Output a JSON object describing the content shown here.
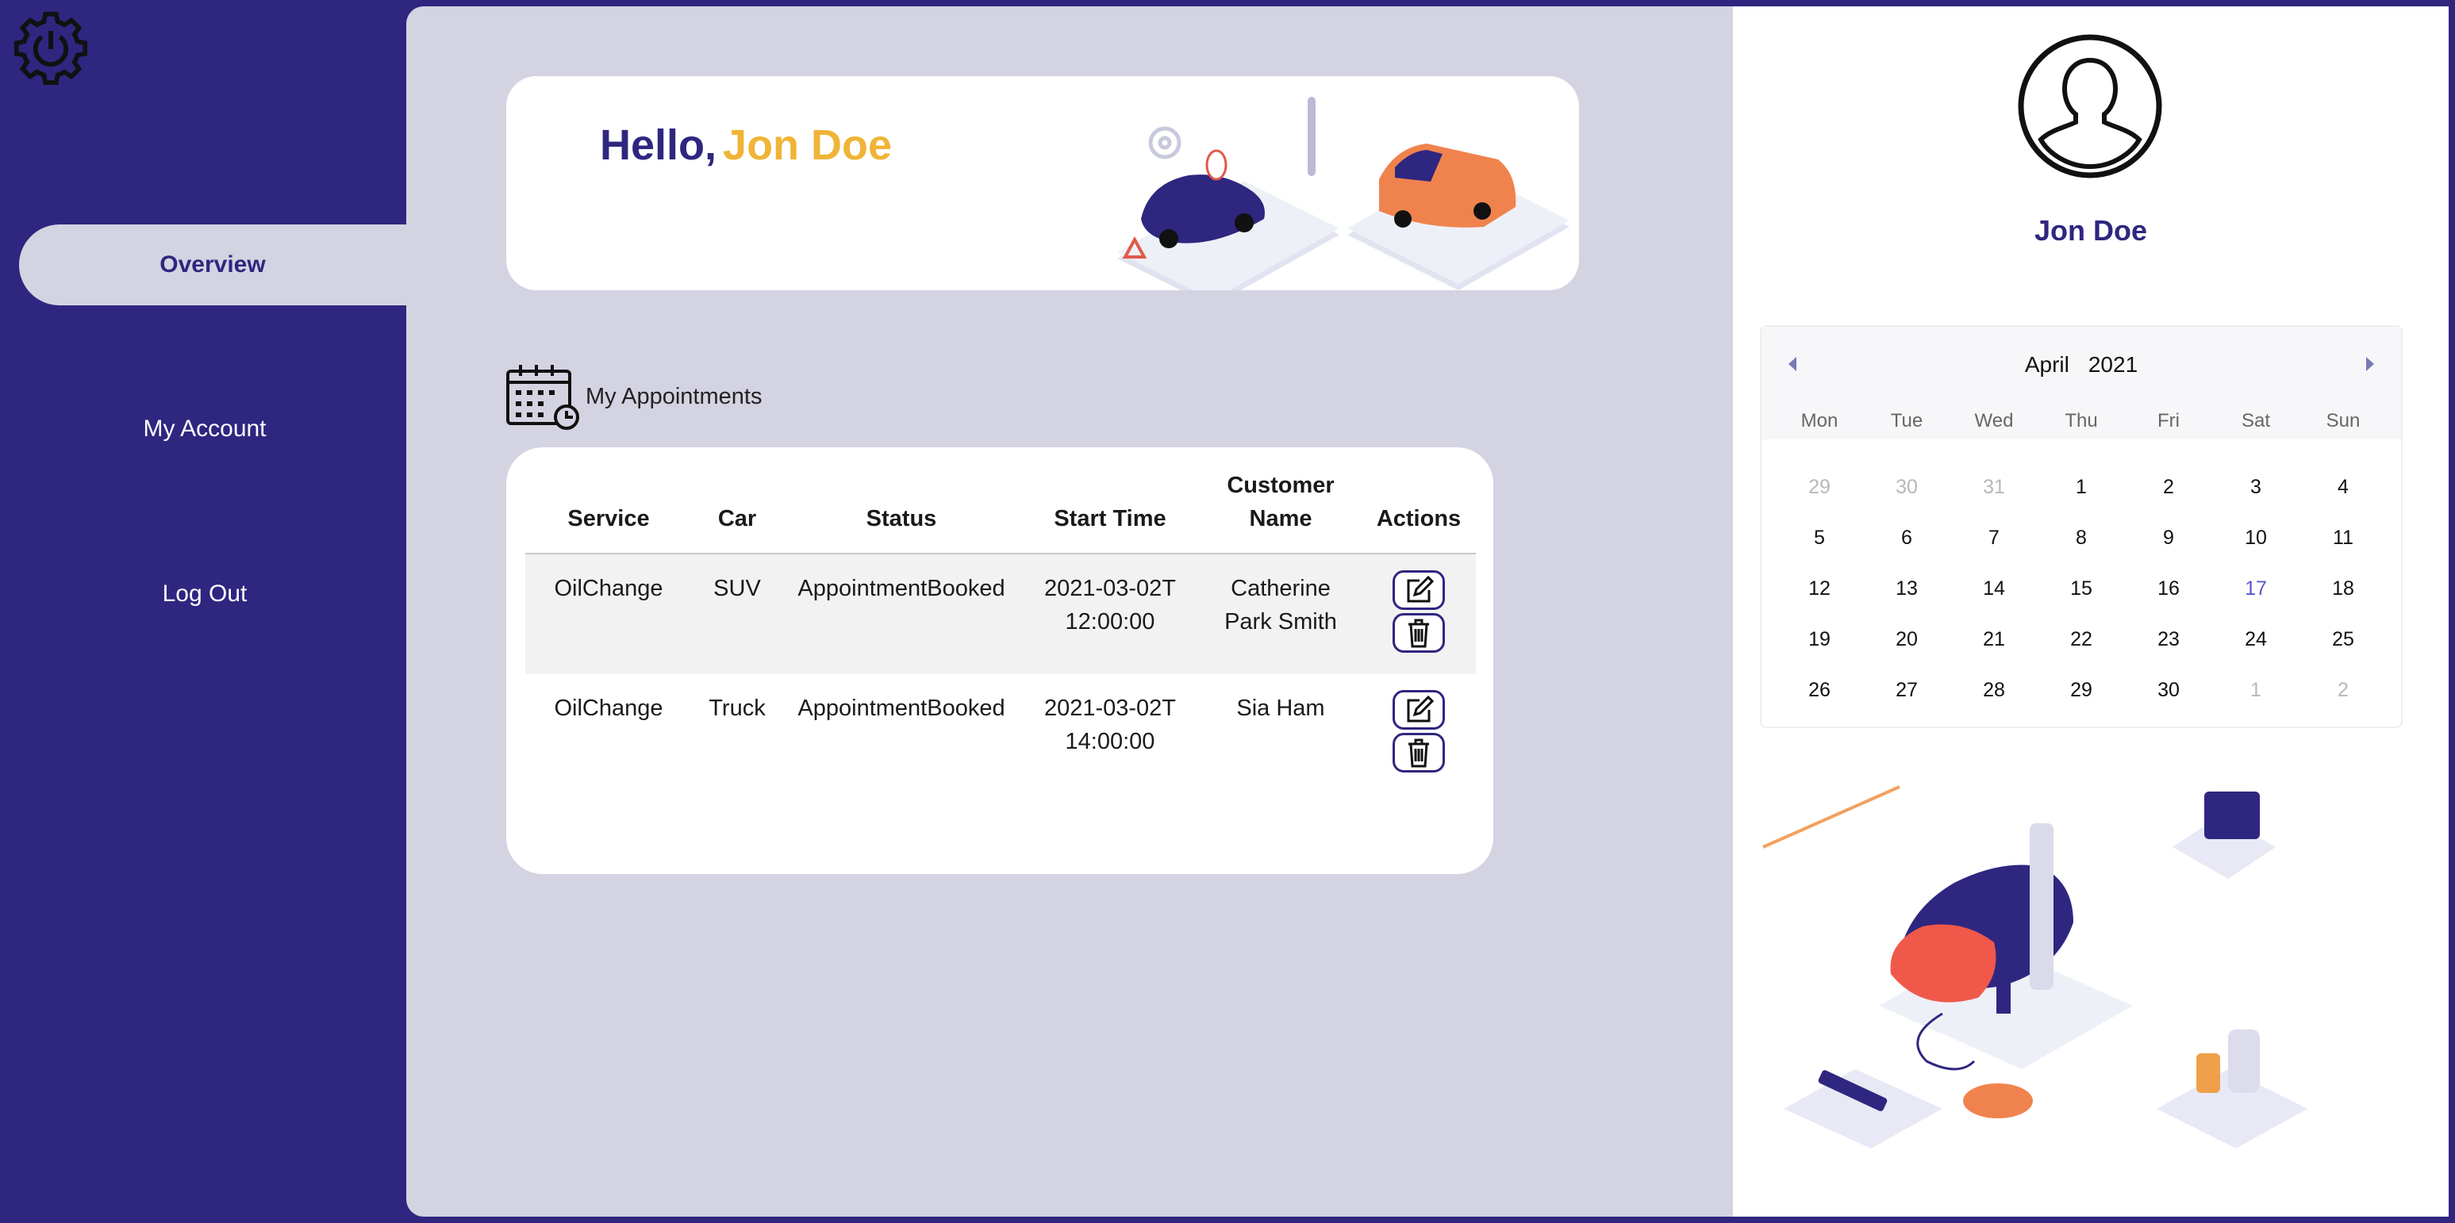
{
  "sidebar": {
    "logo_icon": "gear-power-icon",
    "items": [
      {
        "label": "Overview",
        "active": true
      },
      {
        "label": "My Account",
        "active": false
      },
      {
        "label": "Log Out",
        "active": false
      }
    ]
  },
  "greeting": {
    "hello": "Hello,",
    "name": "Jon Doe"
  },
  "appointments": {
    "title": "My Appointments",
    "columns": [
      "Service",
      "Car",
      "Status",
      "Start Time",
      "Customer Name",
      "Actions"
    ],
    "rows": [
      {
        "service": "OilChange",
        "car": "SUV",
        "status": "AppointmentBooked",
        "start_time": "2021-03-02T12:00:00",
        "customer": "Catherine Park Smith"
      },
      {
        "service": "OilChange",
        "car": "Truck",
        "status": "AppointmentBooked",
        "start_time": "2021-03-02T14:00:00",
        "customer": "Sia Ham"
      }
    ]
  },
  "profile": {
    "name": "Jon Doe",
    "avatar_icon": "user-silhouette-icon"
  },
  "calendar": {
    "month": "April",
    "year": "2021",
    "weekdays": [
      "Mon",
      "Tue",
      "Wed",
      "Thu",
      "Fri",
      "Sat",
      "Sun"
    ],
    "days": [
      {
        "d": "29",
        "muted": true
      },
      {
        "d": "30",
        "muted": true
      },
      {
        "d": "31",
        "muted": true
      },
      {
        "d": "1"
      },
      {
        "d": "2"
      },
      {
        "d": "3"
      },
      {
        "d": "4"
      },
      {
        "d": "5"
      },
      {
        "d": "6"
      },
      {
        "d": "7"
      },
      {
        "d": "8"
      },
      {
        "d": "9"
      },
      {
        "d": "10"
      },
      {
        "d": "11"
      },
      {
        "d": "12"
      },
      {
        "d": "13"
      },
      {
        "d": "14"
      },
      {
        "d": "15"
      },
      {
        "d": "16"
      },
      {
        "d": "17",
        "today": true
      },
      {
        "d": "18"
      },
      {
        "d": "19"
      },
      {
        "d": "20"
      },
      {
        "d": "21"
      },
      {
        "d": "22"
      },
      {
        "d": "23"
      },
      {
        "d": "24"
      },
      {
        "d": "25"
      },
      {
        "d": "26"
      },
      {
        "d": "27"
      },
      {
        "d": "28"
      },
      {
        "d": "29"
      },
      {
        "d": "30"
      },
      {
        "d": "1",
        "muted": true
      },
      {
        "d": "2",
        "muted": true
      }
    ]
  },
  "colors": {
    "brand": "#2f2680",
    "accent": "#f0b437",
    "panel": "#d4d3e2"
  }
}
